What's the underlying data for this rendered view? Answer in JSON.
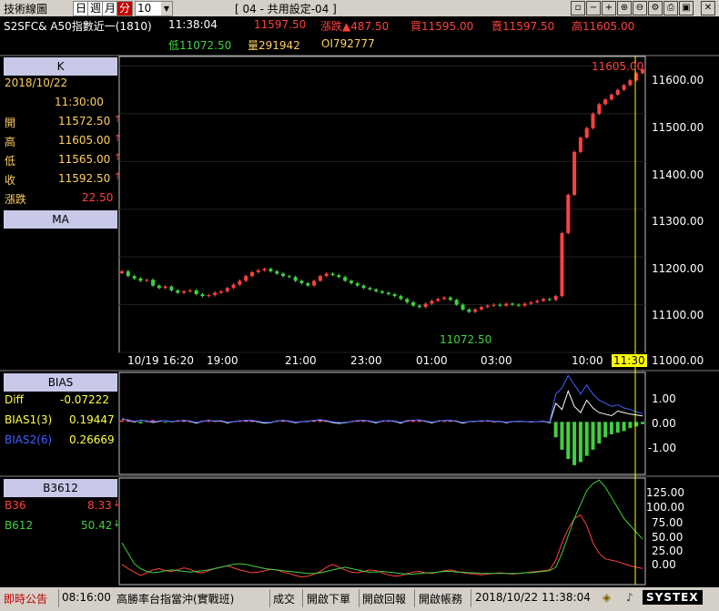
{
  "toolbar": {
    "app_title": "技術線圖",
    "period_day": "日",
    "period_week": "週",
    "period_month": "月",
    "period_minute": "分",
    "interval_value": "10",
    "settings_label": "[ 04 - 共用設定-04 ]"
  },
  "quote": {
    "symbol": "S2SFC& A50指數近一(1810)",
    "time": "11:38:04",
    "last": "11597.50",
    "change_label": "漲跌",
    "change": "487.50",
    "bid_label": "買",
    "bid": "11595.00",
    "ask_label": "賣",
    "ask": "11597.50",
    "high_label": "高",
    "high": "11605.00",
    "low_label": "低",
    "low": "11072.50",
    "volume_label": "量",
    "volume": "291942",
    "oi_label": "OI",
    "oi": "792777"
  },
  "k_panel": {
    "title": "K",
    "date": "2018/10/22",
    "time": "11:30:00",
    "rows": [
      {
        "label": "開",
        "value": "11572.50"
      },
      {
        "label": "高",
        "value": "11605.00"
      },
      {
        "label": "低",
        "value": "11565.00"
      },
      {
        "label": "收",
        "value": "11592.50"
      }
    ],
    "change_label": "漲跌",
    "change": "22.50",
    "ma_title": "MA"
  },
  "bias_panel": {
    "title": "BIAS",
    "rows": [
      {
        "label": "Diff",
        "value": "-0.07222"
      },
      {
        "label": "BIAS1(3)",
        "value": "0.19447"
      },
      {
        "label": "BIAS2(6)",
        "value": "0.26669"
      }
    ]
  },
  "b3612_panel": {
    "title": "B3612",
    "rows": [
      {
        "label": "B36",
        "value": "8.33"
      },
      {
        "label": "B612",
        "value": "50.42"
      }
    ]
  },
  "status_bar": {
    "notice": "即時公告",
    "time": "08:16:00",
    "headline": "高勝率台指當沖(實戰班)",
    "btn_filled": "成交",
    "btn_order": "開啟下單",
    "btn_report": "開啟回報",
    "btn_account": "開啟帳務",
    "datetime": "2018/10/22 11:38:04",
    "brand": "SYSTEX"
  },
  "colors": {
    "up": "#ff4040",
    "down": "#40d040",
    "bias_diff": "#ffff40",
    "bias1": "#ffffff",
    "bias2": "#4060ff",
    "b36": "#ff4040",
    "b612": "#40d040",
    "cursor": "#ffff00",
    "panel_head": "#c8c8e8"
  },
  "chart_data": [
    {
      "type": "candlestick",
      "title": "K",
      "x_ticks": [
        "10/19 16:20",
        "19:00",
        "21:00",
        "23:00",
        "01:00",
        "03:00",
        "10:00",
        "11:30"
      ],
      "y_ticks": [
        "11600.00",
        "11500.00",
        "11400.00",
        "11300.00",
        "11200.00",
        "11100.00",
        "11000.00"
      ],
      "ylim": [
        11000,
        11620
      ],
      "annotations": [
        {
          "text": "11605.00"
        },
        {
          "text": "11072.50"
        }
      ],
      "close": [
        11170,
        11160,
        11155,
        11150,
        11152,
        11140,
        11135,
        11138,
        11130,
        11125,
        11128,
        11130,
        11122,
        11118,
        11120,
        11125,
        11128,
        11135,
        11142,
        11150,
        11160,
        11168,
        11172,
        11175,
        11170,
        11165,
        11160,
        11158,
        11150,
        11145,
        11140,
        11150,
        11160,
        11165,
        11162,
        11158,
        11150,
        11145,
        11140,
        11135,
        11132,
        11128,
        11125,
        11122,
        11118,
        11112,
        11105,
        11098,
        11095,
        11102,
        11108,
        11112,
        11115,
        11110,
        11100,
        11090,
        11085,
        11090,
        11095,
        11098,
        11100,
        11098,
        11102,
        11100,
        11098,
        11102,
        11105,
        11108,
        11112,
        11110,
        11118,
        11250,
        11330,
        11420,
        11450,
        11470,
        11500,
        11520,
        11530,
        11540,
        11550,
        11560,
        11570,
        11585,
        11592.5
      ]
    },
    {
      "type": "bar+line",
      "title": "BIAS",
      "y_ticks": [
        "1.00",
        "0.00",
        "-1.00"
      ],
      "ylim": [
        -1.7,
        1.6
      ],
      "series": [
        {
          "name": "Diff",
          "values": [
            0.05,
            0.08,
            0.03,
            -0.05,
            0.02,
            0.06,
            0.04,
            -0.02,
            0.03,
            0.05,
            0.07,
            0.02,
            -0.03,
            0.04,
            0.06,
            0.03,
            0.05,
            -0.04,
            0.02,
            0.03,
            0.05,
            0.06,
            0.02,
            -0.05,
            -0.03,
            0.04,
            0.05,
            0.03,
            -0.02,
            0.02,
            0.03,
            0.06,
            0.08,
            0.04,
            -0.02,
            -0.06,
            -0.04,
            0.02,
            0.05,
            0.06,
            0.03,
            -0.02,
            0.04,
            0.05,
            0.03,
            -0.03,
            0.05,
            0.06,
            0.07,
            0.03,
            -0.02,
            0.04,
            0.05,
            0.06,
            0.03,
            -0.03,
            0.02,
            0.03,
            0.04,
            0.05,
            0.02,
            0.03,
            -0.02,
            0.02,
            0.03,
            0.02,
            0.01,
            0.02,
            0.03,
            -0.02,
            -0.5,
            -0.9,
            -1.2,
            -1.4,
            -1.3,
            -1.1,
            -0.9,
            -0.7,
            -0.5,
            -0.4,
            -0.35,
            -0.3,
            -0.2,
            -0.15,
            -0.07222
          ]
        },
        {
          "name": "BIAS1(3)",
          "values": [
            0.1,
            0.05,
            0.0,
            0.05,
            0.03,
            -0.02,
            0.02,
            0.04,
            0.0,
            0.03,
            0.05,
            0.02,
            -0.04,
            0.02,
            0.05,
            0.02,
            0.03,
            -0.03,
            0.01,
            0.03,
            0.05,
            0.04,
            0.0,
            -0.04,
            -0.02,
            0.03,
            0.05,
            0.02,
            -0.03,
            0.01,
            0.02,
            0.05,
            0.06,
            0.03,
            -0.02,
            -0.05,
            -0.03,
            0.01,
            0.04,
            0.05,
            0.02,
            -0.03,
            0.03,
            0.04,
            0.02,
            -0.04,
            0.04,
            0.05,
            0.06,
            0.02,
            -0.03,
            0.03,
            0.04,
            0.05,
            0.02,
            -0.04,
            0.01,
            0.02,
            0.03,
            0.04,
            0.01,
            0.02,
            -0.03,
            0.01,
            0.02,
            0.01,
            0.0,
            0.01,
            0.02,
            -0.03,
            0.6,
            0.4,
            1.0,
            0.5,
            0.3,
            0.7,
            0.45,
            0.3,
            0.25,
            0.2,
            0.35,
            0.3,
            0.25,
            0.22,
            0.19447
          ]
        },
        {
          "name": "BIAS2(6)",
          "values": [
            0.08,
            0.06,
            0.02,
            0.04,
            0.03,
            0.0,
            0.03,
            0.04,
            0.01,
            0.03,
            0.05,
            0.03,
            -0.02,
            0.02,
            0.04,
            0.03,
            0.04,
            -0.01,
            0.01,
            0.03,
            0.05,
            0.05,
            0.02,
            -0.02,
            -0.01,
            0.03,
            0.05,
            0.03,
            -0.01,
            0.01,
            0.02,
            0.05,
            0.07,
            0.04,
            0.0,
            -0.03,
            -0.02,
            0.01,
            0.04,
            0.05,
            0.03,
            -0.01,
            0.03,
            0.04,
            0.03,
            -0.02,
            0.04,
            0.05,
            0.06,
            0.03,
            -0.01,
            0.03,
            0.04,
            0.05,
            0.03,
            -0.02,
            0.01,
            0.02,
            0.03,
            0.04,
            0.02,
            0.02,
            -0.01,
            0.01,
            0.02,
            0.01,
            0.01,
            0.01,
            0.02,
            -0.01,
            0.9,
            1.1,
            1.5,
            1.2,
            0.9,
            1.2,
            0.9,
            0.7,
            0.6,
            0.5,
            0.55,
            0.45,
            0.4,
            0.33,
            0.26669
          ]
        }
      ]
    },
    {
      "type": "line",
      "title": "B3612",
      "y_ticks": [
        "125.00",
        "100.00",
        "75.00",
        "50.00",
        "25.00",
        "0.00"
      ],
      "ylim": [
        -15,
        138
      ],
      "series": [
        {
          "name": "B36",
          "values": [
            14,
            8,
            3,
            -2,
            2,
            6,
            8,
            5,
            4,
            6,
            9,
            7,
            3,
            2,
            5,
            8,
            10,
            12,
            9,
            6,
            4,
            2,
            3,
            5,
            7,
            6,
            3,
            1,
            -2,
            -4,
            -3,
            0,
            4,
            10,
            14,
            10,
            6,
            3,
            2,
            4,
            6,
            5,
            2,
            -1,
            -3,
            -2,
            1,
            3,
            4,
            2,
            1,
            3,
            5,
            6,
            4,
            2,
            1,
            0,
            -1,
            0,
            1,
            2,
            1,
            0,
            1,
            2,
            3,
            4,
            5,
            6,
            20,
            45,
            65,
            80,
            85,
            70,
            45,
            30,
            22,
            20,
            18,
            15,
            12,
            10,
            8.33
          ]
        },
        {
          "name": "B612",
          "values": [
            45,
            30,
            15,
            8,
            4,
            2,
            3,
            5,
            6,
            5,
            4,
            3,
            4,
            5,
            6,
            8,
            10,
            12,
            14,
            15,
            14,
            12,
            10,
            8,
            7,
            6,
            5,
            4,
            3,
            2,
            1,
            1,
            2,
            4,
            6,
            8,
            10,
            8,
            6,
            4,
            3,
            3,
            4,
            3,
            2,
            1,
            0,
            0,
            1,
            2,
            2,
            3,
            4,
            4,
            3,
            3,
            2,
            2,
            1,
            1,
            1,
            1,
            1,
            1,
            1,
            2,
            2,
            3,
            4,
            5,
            10,
            30,
            55,
            80,
            100,
            120,
            130,
            135,
            125,
            110,
            95,
            80,
            70,
            60,
            50.42
          ]
        }
      ]
    }
  ]
}
